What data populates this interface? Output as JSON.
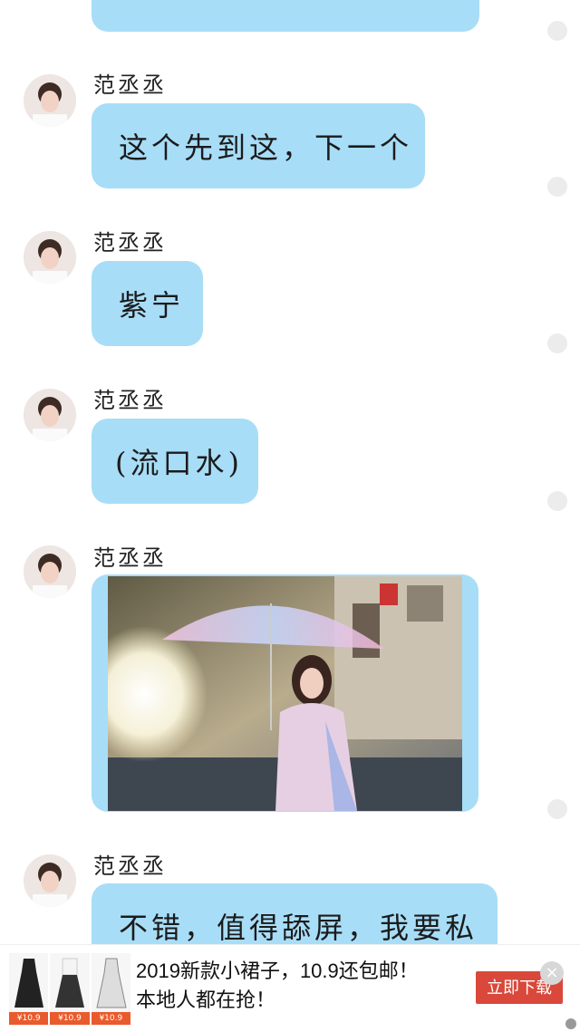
{
  "messages": [
    {
      "name": "范丞丞",
      "text": "这个先到这，下一个"
    },
    {
      "name": "范丞丞",
      "text": "紫宁"
    },
    {
      "name": "范丞丞",
      "text": "(流口水)"
    },
    {
      "name": "范丞丞",
      "image": "woman-with-umbrella-photo"
    },
    {
      "name": "范丞丞",
      "text": "不错，值得舔屏，我要私"
    }
  ],
  "ad": {
    "line1": "2019新款小裙子，10.9还包邮！",
    "line2": "本地人都在抢！",
    "button": "立即下载",
    "close": "×",
    "thumb_prices": [
      "¥10.9",
      "¥10.9",
      "¥10.9"
    ]
  },
  "colors": {
    "bubble": "#a8ddf7",
    "ad_button": "#d9483b"
  }
}
